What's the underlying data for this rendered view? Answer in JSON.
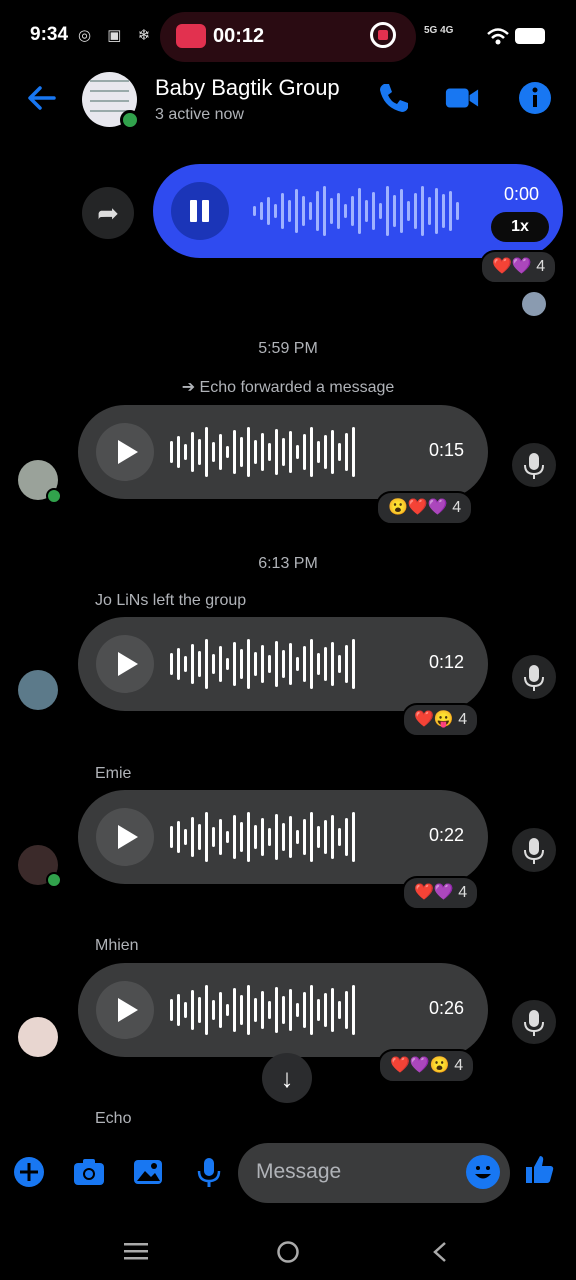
{
  "status_bar": {
    "time": "9:34",
    "left_icons": "◎ ▣ ❄ F",
    "recording_time": "00:12",
    "network": "5G 4G"
  },
  "header": {
    "back_icon": "back-arrow-icon",
    "group_name": "Baby Bagtik Group",
    "active_status": "3 active now",
    "accent_color": "#1877f2"
  },
  "messages": {
    "mine": {
      "duration": "0:00",
      "speed": "1x",
      "reactions": "❤️💜 4"
    },
    "time_1": "5:59 PM",
    "forward_note": "➔ Echo forwarded a message",
    "voice_1": {
      "duration": "0:15",
      "reactions": "😮❤️💜 4"
    },
    "time_2": "6:13 PM",
    "left_note": "Jo LiNs left the group",
    "voice_2": {
      "duration": "0:12",
      "reactions": "❤️😛 4"
    },
    "sender_3": "Emie",
    "voice_3": {
      "duration": "0:22",
      "reactions": "❤️💜 4"
    },
    "sender_4": "Mhien",
    "voice_4": {
      "duration": "0:26",
      "reactions": "❤️💜😮 4"
    },
    "sender_5": "Echo"
  },
  "composer": {
    "placeholder": "Message"
  }
}
